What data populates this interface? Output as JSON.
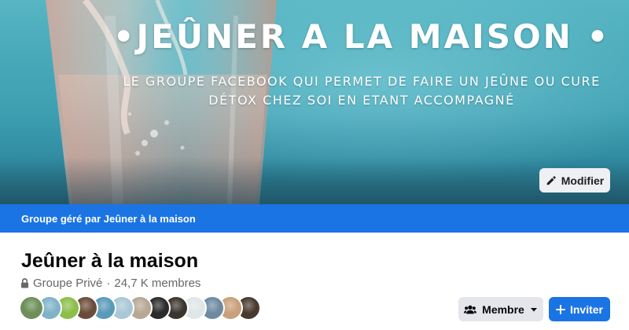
{
  "cover": {
    "title": "•JEÛNER A LA MAISON •",
    "subtitle_line1": "LE GROUPE FACEBOOK QUI PERMET DE FAIRE UN JEÛNE OU CURE",
    "subtitle_line2": "DÉTOX CHEZ SOI EN ETANT ACCOMPAGNÉ",
    "edit_button_label": "Modifier"
  },
  "managed_bar": {
    "text": "Groupe géré par Jeûner à la maison"
  },
  "group": {
    "name": "Jeûner à la maison",
    "privacy": "Groupe Privé",
    "separator": "·",
    "members": "24,7 K membres"
  },
  "avatars": [
    {
      "icon": "member-avatar-1",
      "color": "#6e8f5a"
    },
    {
      "icon": "member-avatar-2",
      "color": "#7fb3c8"
    },
    {
      "icon": "member-avatar-3",
      "color": "#8bbf4a"
    },
    {
      "icon": "member-avatar-4",
      "color": "#6a4c3a"
    },
    {
      "icon": "member-avatar-5",
      "color": "#5a9ab8"
    },
    {
      "icon": "member-avatar-6",
      "color": "#a9c7d6"
    },
    {
      "icon": "member-avatar-7",
      "color": "#b7a794"
    },
    {
      "icon": "member-avatar-8",
      "color": "#2b2b2b"
    },
    {
      "icon": "member-avatar-9",
      "color": "#3b3530"
    },
    {
      "icon": "member-avatar-10",
      "color": "#dfe6e8"
    },
    {
      "icon": "member-avatar-11",
      "color": "#6d8aa0"
    },
    {
      "icon": "member-avatar-12",
      "color": "#c9a07a"
    },
    {
      "icon": "member-avatar-13",
      "color": "#4a3a2e"
    }
  ],
  "actions": {
    "member_label": "Membre",
    "invite_label": "Inviter"
  },
  "colors": {
    "brand_blue": "#1b74e4",
    "button_grey": "#e4e6eb"
  }
}
